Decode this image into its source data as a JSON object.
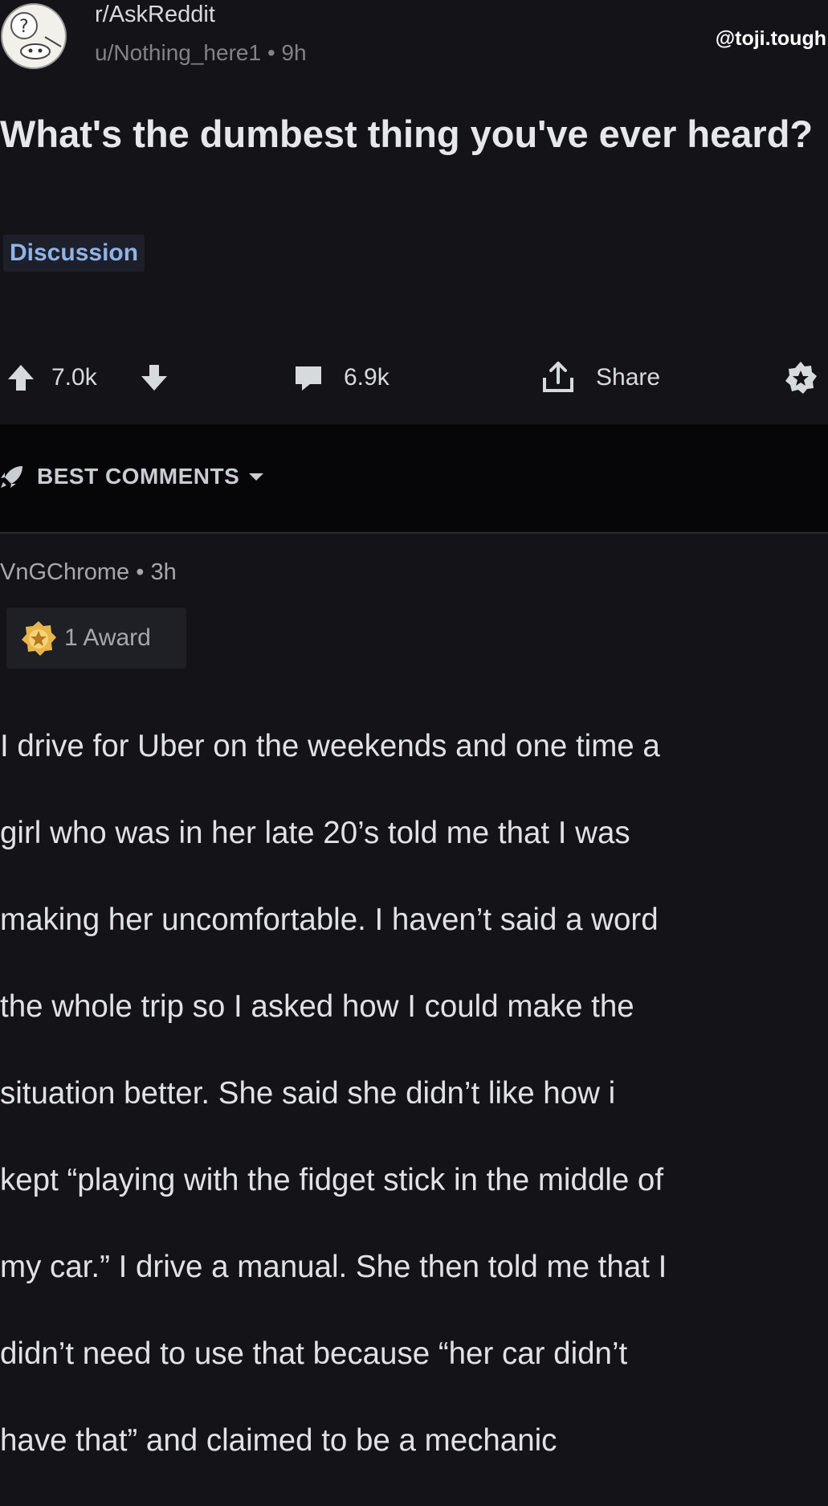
{
  "post": {
    "subreddit": "r/AskReddit",
    "author": "u/Nothing_here1",
    "age": "9h",
    "title": "What's the dumbest thing you've ever heard?",
    "flair": "Discussion",
    "score": "7.0k",
    "comment_count": "6.9k",
    "share_label": "Share",
    "icons": {
      "avatar": "question-mark-snoo-avatar",
      "upvote": "arrow-up-icon",
      "downvote": "arrow-down-icon",
      "comments": "comment-bubble-icon",
      "share": "share-icon",
      "award": "award-icon"
    }
  },
  "watermark": "@toji.tough",
  "sort": {
    "label": "BEST COMMENTS",
    "icon": "rocket-icon"
  },
  "comment": {
    "author": "VnGChrome",
    "age": "3h",
    "award_label": "1 Award",
    "body_lines": [
      "I drive for Uber on the weekends and one time a",
      "girl who was in her late 20’s told me that I was",
      "making her uncomfortable. I haven’t said a word",
      "the whole trip so I asked how I could make the",
      "situation better. She said she didn’t like how i",
      "kept “playing with the fidget stick in the middle of",
      "my car.” I drive a manual. She then told me that I",
      "didn’t need to use that because “her car didn’t",
      "have that” and claimed to be a mechanic"
    ]
  },
  "colors": {
    "background": "#141318",
    "sortbar": "#060608",
    "flair_text": "#8fb3e6",
    "award_gold": "#e8b54a"
  }
}
